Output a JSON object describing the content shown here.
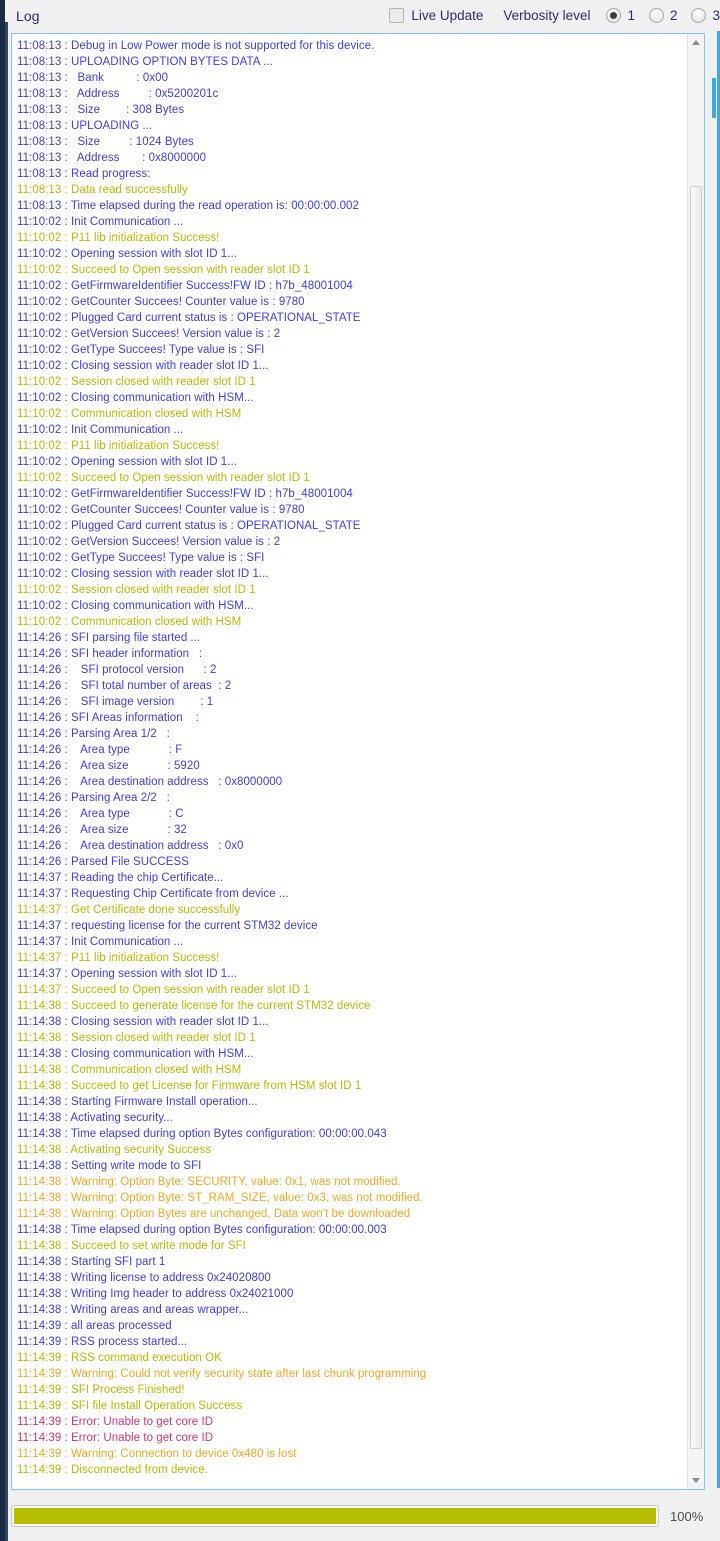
{
  "header": {
    "title": "Log",
    "live_update_label": "Live Update",
    "live_update_checked": false,
    "verbosity_label": "Verbosity level",
    "radios": [
      {
        "label": "1",
        "checked": true
      },
      {
        "label": "2",
        "checked": false
      },
      {
        "label": "3",
        "checked": false
      }
    ]
  },
  "colors": {
    "info": "#3c3cf0",
    "success": "#b5bd00",
    "warning": "#f5a623",
    "error": "#d6336c",
    "accent": "#3fa7e0",
    "progress": "#b5bd00",
    "panel_border": "#7ec5ef",
    "header_text": "#2b2b6e"
  },
  "progress": {
    "percent_label": "100%",
    "percent_value": 100
  },
  "scrollbar": {
    "up_arrow": "chevron-up-icon",
    "down_arrow": "chevron-down-icon"
  },
  "log": {
    "lines": [
      {
        "t": "info",
        "text": "11:08:13 : Debug in Low Power mode is not supported for this device."
      },
      {
        "t": "info",
        "text": "11:08:13 : UPLOADING OPTION BYTES DATA ..."
      },
      {
        "t": "info",
        "text": "11:08:13 :   Bank          : 0x00"
      },
      {
        "t": "info",
        "text": "11:08:13 :   Address         : 0x5200201c"
      },
      {
        "t": "info",
        "text": "11:08:13 :   Size        : 308 Bytes"
      },
      {
        "t": "info",
        "text": "11:08:13 : UPLOADING ..."
      },
      {
        "t": "info",
        "text": "11:08:13 :   Size         : 1024 Bytes"
      },
      {
        "t": "info",
        "text": "11:08:13 :   Address       : 0x8000000"
      },
      {
        "t": "info",
        "text": "11:08:13 : Read progress:"
      },
      {
        "t": "success",
        "text": "11:08:13 : Data read successfully"
      },
      {
        "t": "info",
        "text": "11:08:13 : Time elapsed during the read operation is: 00:00:00.002"
      },
      {
        "t": "info",
        "text": "11:10:02 : Init Communication ..."
      },
      {
        "t": "success",
        "text": "11:10:02 : P11 lib initialization Success!"
      },
      {
        "t": "info",
        "text": "11:10:02 : Opening session with slot ID 1..."
      },
      {
        "t": "success",
        "text": "11:10:02 : Succeed to Open session with reader slot ID 1"
      },
      {
        "t": "info",
        "text": "11:10:02 : GetFirmwareIdentifier Success!FW ID : h7b_48001004"
      },
      {
        "t": "info",
        "text": "11:10:02 : GetCounter Succees! Counter value is : 9780"
      },
      {
        "t": "info",
        "text": "11:10:02 : Plugged Card current status is : OPERATIONAL_STATE"
      },
      {
        "t": "info",
        "text": "11:10:02 : GetVersion Succees! Version value is : 2"
      },
      {
        "t": "info",
        "text": "11:10:02 : GetType Succees! Type value is : SFI"
      },
      {
        "t": "info",
        "text": "11:10:02 : Closing session with reader slot ID 1..."
      },
      {
        "t": "success",
        "text": "11:10:02 : Session closed with reader slot ID 1"
      },
      {
        "t": "info",
        "text": "11:10:02 : Closing communication with HSM..."
      },
      {
        "t": "success",
        "text": "11:10:02 : Communication closed with HSM"
      },
      {
        "t": "info",
        "text": "11:10:02 : Init Communication ..."
      },
      {
        "t": "success",
        "text": "11:10:02 : P11 lib initialization Success!"
      },
      {
        "t": "info",
        "text": "11:10:02 : Opening session with slot ID 1..."
      },
      {
        "t": "success",
        "text": "11:10:02 : Succeed to Open session with reader slot ID 1"
      },
      {
        "t": "info",
        "text": "11:10:02 : GetFirmwareIdentifier Success!FW ID : h7b_48001004"
      },
      {
        "t": "info",
        "text": "11:10:02 : GetCounter Succees! Counter value is : 9780"
      },
      {
        "t": "info",
        "text": "11:10:02 : Plugged Card current status is : OPERATIONAL_STATE"
      },
      {
        "t": "info",
        "text": "11:10:02 : GetVersion Succees! Version value is : 2"
      },
      {
        "t": "info",
        "text": "11:10:02 : GetType Succees! Type value is : SFI"
      },
      {
        "t": "info",
        "text": "11:10:02 : Closing session with reader slot ID 1..."
      },
      {
        "t": "success",
        "text": "11:10:02 : Session closed with reader slot ID 1"
      },
      {
        "t": "info",
        "text": "11:10:02 : Closing communication with HSM..."
      },
      {
        "t": "success",
        "text": "11:10:02 : Communication closed with HSM"
      },
      {
        "t": "info",
        "text": "11:14:26 : SFI parsing file started ..."
      },
      {
        "t": "info",
        "text": "11:14:26 : SFI header information   :"
      },
      {
        "t": "info",
        "text": "11:14:26 :    SFI protocol version      : 2"
      },
      {
        "t": "info",
        "text": "11:14:26 :    SFI total number of areas  : 2"
      },
      {
        "t": "info",
        "text": "11:14:26 :    SFI image version        : 1"
      },
      {
        "t": "info",
        "text": "11:14:26 : SFI Areas information    :"
      },
      {
        "t": "info",
        "text": "11:14:26 : Parsing Area 1/2   :"
      },
      {
        "t": "info",
        "text": "11:14:26 :    Area type            : F"
      },
      {
        "t": "info",
        "text": "11:14:26 :    Area size            : 5920"
      },
      {
        "t": "info",
        "text": "11:14:26 :    Area destination address   : 0x8000000"
      },
      {
        "t": "info",
        "text": "11:14:26 : Parsing Area 2/2   :"
      },
      {
        "t": "info",
        "text": "11:14:26 :    Area type            : C"
      },
      {
        "t": "info",
        "text": "11:14:26 :    Area size            : 32"
      },
      {
        "t": "info",
        "text": "11:14:26 :    Area destination address   : 0x0"
      },
      {
        "t": "info",
        "text": "11:14:26 : Parsed File SUCCESS"
      },
      {
        "t": "info",
        "text": "11:14:37 : Reading the chip Certificate..."
      },
      {
        "t": "info",
        "text": "11:14:37 : Requesting Chip Certificate from device ..."
      },
      {
        "t": "success",
        "text": "11:14:37 : Get Certificate done successfully"
      },
      {
        "t": "info",
        "text": "11:14:37 : requesting license for the current STM32 device"
      },
      {
        "t": "info",
        "text": "11:14:37 : Init Communication ..."
      },
      {
        "t": "success",
        "text": "11:14:37 : P11 lib initialization Success!"
      },
      {
        "t": "info",
        "text": "11:14:37 : Opening session with slot ID 1..."
      },
      {
        "t": "success",
        "text": "11:14:37 : Succeed to Open session with reader slot ID 1"
      },
      {
        "t": "success",
        "text": "11:14:38 : Succeed to generate license for the current STM32 device"
      },
      {
        "t": "info",
        "text": "11:14:38 : Closing session with reader slot ID 1..."
      },
      {
        "t": "success",
        "text": "11:14:38 : Session closed with reader slot ID 1"
      },
      {
        "t": "info",
        "text": "11:14:38 : Closing communication with HSM..."
      },
      {
        "t": "success",
        "text": "11:14:38 : Communication closed with HSM"
      },
      {
        "t": "success",
        "text": "11:14:38 : Succeed to get License for Firmware from HSM slot ID 1"
      },
      {
        "t": "info",
        "text": "11:14:38 : Starting Firmware Install operation..."
      },
      {
        "t": "info",
        "text": "11:14:38 : Activating security..."
      },
      {
        "t": "info",
        "text": "11:14:38 : Time elapsed during option Bytes configuration: 00:00:00.043"
      },
      {
        "t": "success",
        "text": "11:14:38 : Activating security Success"
      },
      {
        "t": "info",
        "text": "11:14:38 : Setting write mode to SFI"
      },
      {
        "t": "warning",
        "text": "11:14:38 : Warning: Option Byte: SECURITY, value: 0x1, was not modified."
      },
      {
        "t": "warning",
        "text": "11:14:38 : Warning: Option Byte: ST_RAM_SIZE, value: 0x3, was not modified."
      },
      {
        "t": "warning",
        "text": "11:14:38 : Warning: Option Bytes are unchanged, Data won't be downloaded"
      },
      {
        "t": "info",
        "text": "11:14:38 : Time elapsed during option Bytes configuration: 00:00:00.003"
      },
      {
        "t": "success",
        "text": "11:14:38 : Succeed to set write mode for SFI"
      },
      {
        "t": "info",
        "text": "11:14:38 : Starting SFI part 1"
      },
      {
        "t": "info",
        "text": "11:14:38 : Writing license to address 0x24020800"
      },
      {
        "t": "info",
        "text": "11:14:38 : Writing Img header to address 0x24021000"
      },
      {
        "t": "info",
        "text": "11:14:38 : Writing areas and areas wrapper..."
      },
      {
        "t": "info",
        "text": "11:14:39 : all areas processed"
      },
      {
        "t": "info",
        "text": "11:14:39 : RSS process started..."
      },
      {
        "t": "success",
        "text": "11:14:39 : RSS command execution OK"
      },
      {
        "t": "warning",
        "text": "11:14:39 : Warning: Could not verify security state after last chunk programming"
      },
      {
        "t": "success",
        "text": "11:14:39 : SFI Process Finished!"
      },
      {
        "t": "success",
        "text": "11:14:39 : SFI file Install Operation Success"
      },
      {
        "t": "error",
        "text": "11:14:39 : Error: Unable to get core ID"
      },
      {
        "t": "error",
        "text": "11:14:39 : Error: Unable to get core ID"
      },
      {
        "t": "warning",
        "text": "11:14:39 : Warning: Connection to device 0x480 is lost"
      },
      {
        "t": "success",
        "text": "11:14:39 : Disconnected from device."
      }
    ]
  }
}
